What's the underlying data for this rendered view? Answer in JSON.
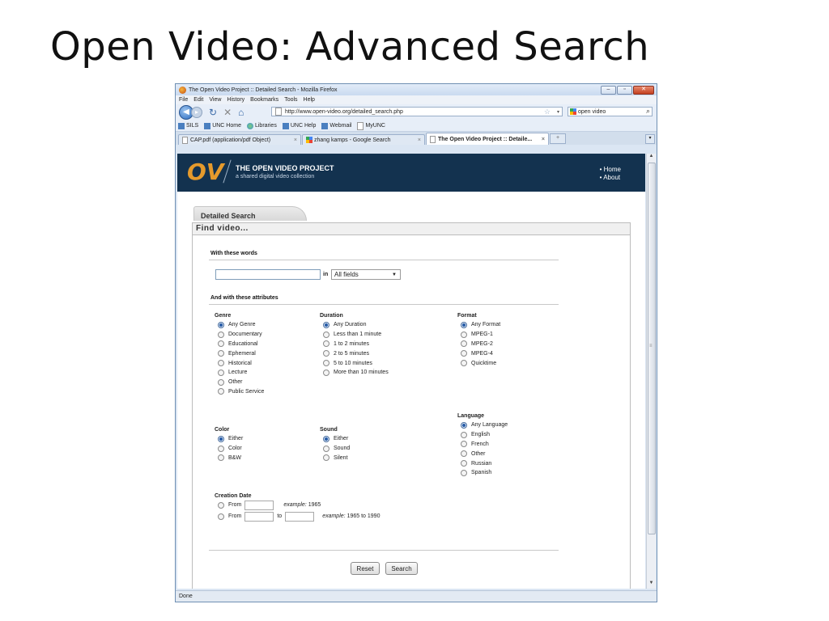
{
  "slide": {
    "title": "Open Video: Advanced Search"
  },
  "browser": {
    "window_title": "The Open Video Project :: Detailed Search - Mozilla Firefox",
    "menu": [
      "File",
      "Edit",
      "View",
      "History",
      "Bookmarks",
      "Tools",
      "Help"
    ],
    "url": "http://www.open-video.org/detailed_search.php",
    "search_value": "open video",
    "bookmarks": [
      "SILS",
      "UNC Home",
      "Libraries",
      "UNC Help",
      "Webmail",
      "MyUNC"
    ],
    "tabs": [
      "CAP.pdf (application/pdf Object)",
      "zhang kamps - Google Search",
      "The Open Video Project :: Detaile..."
    ],
    "status": "Done"
  },
  "site": {
    "logo": "OV",
    "title": "THE OPEN VIDEO PROJECT",
    "subtitle": "a shared digital video collection",
    "nav": [
      "• Home",
      "• About"
    ]
  },
  "search": {
    "tab_label": "Detailed Search",
    "find_label": "Find video...",
    "words_heading": "With these words",
    "in_label": "in",
    "field_select": "All fields",
    "attributes_heading": "And with these attributes",
    "genre": {
      "title": "Genre",
      "options": [
        "Any Genre",
        "Documentary",
        "Educational",
        "Ephemeral",
        "Historical",
        "Lecture",
        "Other",
        "Public Service"
      ]
    },
    "duration": {
      "title": "Duration",
      "options": [
        "Any Duration",
        "Less than 1 minute",
        "1 to 2 minutes",
        "2 to 5 minutes",
        "5 to 10 minutes",
        "More than 10 minutes"
      ]
    },
    "format": {
      "title": "Format",
      "options": [
        "Any Format",
        "MPEG-1",
        "MPEG-2",
        "MPEG-4",
        "Quicktime"
      ]
    },
    "language": {
      "title": "Language",
      "options": [
        "Any Language",
        "English",
        "French",
        "Other",
        "Russian",
        "Spanish"
      ]
    },
    "color": {
      "title": "Color",
      "options": [
        "Either",
        "Color",
        "B&W"
      ]
    },
    "sound": {
      "title": "Sound",
      "options": [
        "Either",
        "Sound",
        "Silent"
      ]
    },
    "creation": {
      "title": "Creation Date",
      "from_label": "From",
      "to_label": "to",
      "example_label": "example:",
      "example1": "1965",
      "example2": "1965 to 1990"
    },
    "reset_label": "Reset",
    "search_label": "Search"
  }
}
